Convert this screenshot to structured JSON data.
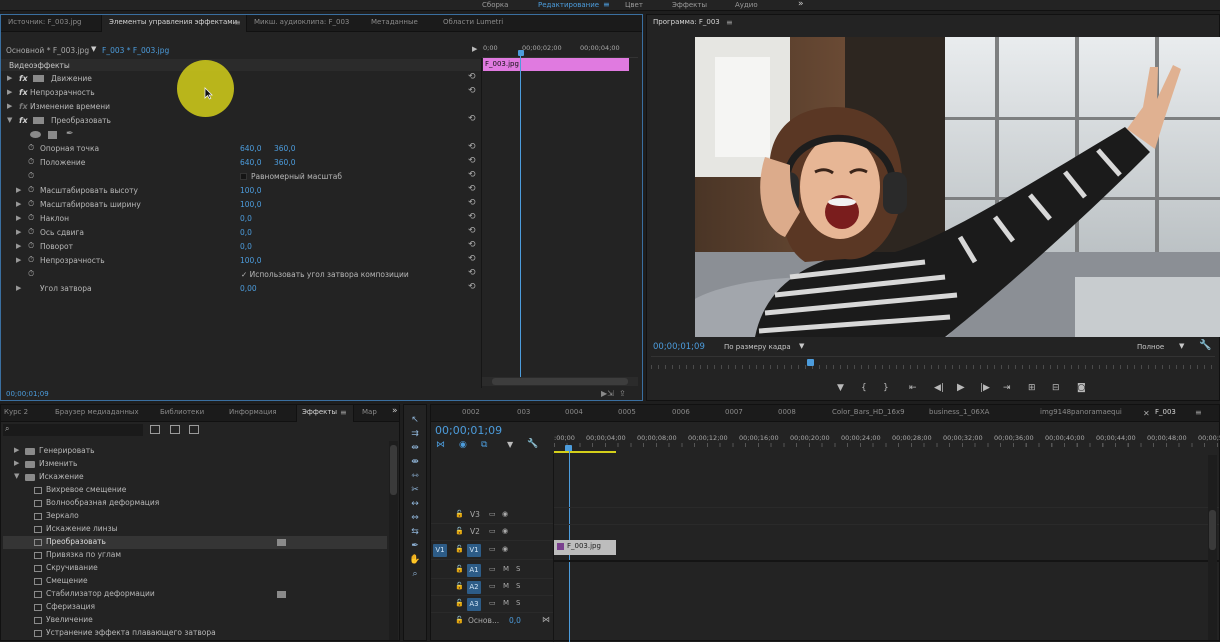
{
  "workspace": {
    "items": [
      "Сборка",
      "Редактирование",
      "Цвет",
      "Эффекты",
      "Аудио"
    ],
    "active": "Редактирование",
    "menu_glyph": "≡",
    "more_glyph": "»"
  },
  "source_panel": {
    "tabs": [
      "Источник: F_003.jpg",
      "Элементы управления эффектами",
      "Микш. аудиоклипа: F_003",
      "Метаданные",
      "Области Lumetri"
    ],
    "active_tab_menu": "≡",
    "master_label": "Основной * F_003.jpg",
    "clip_label": "F_003 * F_003.jpg",
    "video_effects_header": "Видеоэффекты",
    "mini_ruler": [
      "0;00",
      "00;00;02;00",
      "00;00;04;00"
    ],
    "clip_bar_label": "F_003.jpg",
    "timecode": "00;00;01;09",
    "effects": [
      {
        "name": "Движение"
      },
      {
        "name": "Непрозрачность"
      },
      {
        "name": "Изменение времени"
      },
      {
        "name": "Преобразовать"
      }
    ],
    "transform_props": [
      {
        "name": "Опорная точка",
        "v1": "640,0",
        "v2": "360,0"
      },
      {
        "name": "Положение",
        "v1": "640,0",
        "v2": "360,0"
      },
      {
        "name": "",
        "v1": "",
        "v2": "",
        "check": "Равномерный масштаб"
      },
      {
        "name": "Масштабировать высоту",
        "v1": "100,0"
      },
      {
        "name": "Масштабировать ширину",
        "v1": "100,0"
      },
      {
        "name": "Наклон",
        "v1": "0,0"
      },
      {
        "name": "Ось сдвига",
        "v1": "0,0"
      },
      {
        "name": "Поворот",
        "v1": "0,0"
      },
      {
        "name": "Непрозрачность",
        "v1": "100,0"
      },
      {
        "name": "",
        "v1": "",
        "check": "✓ Использовать угол затвора композиции"
      },
      {
        "name": "Угол затвора",
        "v1": "0,00"
      }
    ]
  },
  "program_monitor": {
    "title": "Программа: F_003",
    "menu_glyph": "≡",
    "timecode": "00;00;01;09",
    "fit_label": "По размеру кадра",
    "quality_label": "Полное",
    "controls": [
      "marker",
      "in",
      "out",
      "go-in",
      "step-back",
      "play",
      "step-forward",
      "go-out",
      "lift",
      "extract",
      "export-frame"
    ]
  },
  "effects_panel": {
    "tabs": [
      "Курс 2",
      "Браузер медиаданных",
      "Библиотеки",
      "Информация",
      "Эффекты",
      "Мар"
    ],
    "active_tab": "Эффекты",
    "more_glyph": "»",
    "tree": [
      {
        "label": "Генерировать",
        "type": "folder",
        "expanded": false
      },
      {
        "label": "Изменить",
        "type": "folder",
        "expanded": false
      },
      {
        "label": "Искажение",
        "type": "folder",
        "expanded": true
      },
      {
        "label": "Вихревое смещение",
        "type": "item"
      },
      {
        "label": "Волнообразная деформация",
        "type": "item"
      },
      {
        "label": "Зеркало",
        "type": "item"
      },
      {
        "label": "Искажение линзы",
        "type": "item"
      },
      {
        "label": "Преобразовать",
        "type": "item",
        "selected": true,
        "accel": true
      },
      {
        "label": "Привязка по углам",
        "type": "item"
      },
      {
        "label": "Скручивание",
        "type": "item"
      },
      {
        "label": "Смещение",
        "type": "item"
      },
      {
        "label": "Стабилизатор деформации",
        "type": "item",
        "accel": true
      },
      {
        "label": "Сферизация",
        "type": "item"
      },
      {
        "label": "Увеличение",
        "type": "item"
      },
      {
        "label": "Устранение эффекта плавающего затвора",
        "type": "item"
      }
    ]
  },
  "timeline": {
    "tabs": [
      "0002",
      "003",
      "0004",
      "0005",
      "0006",
      "0007",
      "0008",
      "Color_Bars_HD_16x9",
      "business_1_06XA",
      "img9148panoramaequi",
      "F_003"
    ],
    "active_tab": "F_003",
    "menu_glyph": "≡",
    "timecode": "00;00;01;09",
    "ruler": [
      ":00;00",
      "00;00;04;00",
      "00;00;08;00",
      "00;00;12;00",
      "00;00;16;00",
      "00;00;20;00",
      "00;00;24;00",
      "00;00;28;00",
      "00;00;32;00",
      "00;00;36;00",
      "00;00;40;00",
      "00;00;44;00",
      "00;00;48;00",
      "00;00;5"
    ],
    "video_tracks": [
      "V3",
      "V2",
      "V1"
    ],
    "audio_tracks": [
      "A1",
      "A2",
      "A3"
    ],
    "source_patch_video": "V1",
    "master_label": "Основ...",
    "master_value": "0,0",
    "clip_label": "F_003.jpg",
    "mute_label": "M",
    "solo_label": "S"
  },
  "colors": {
    "accent": "#4c9cdc",
    "clip_pink": "#e07ae0",
    "clip_gray": "#bdbdbd",
    "cursor_highlight": "#d4cf1a"
  }
}
